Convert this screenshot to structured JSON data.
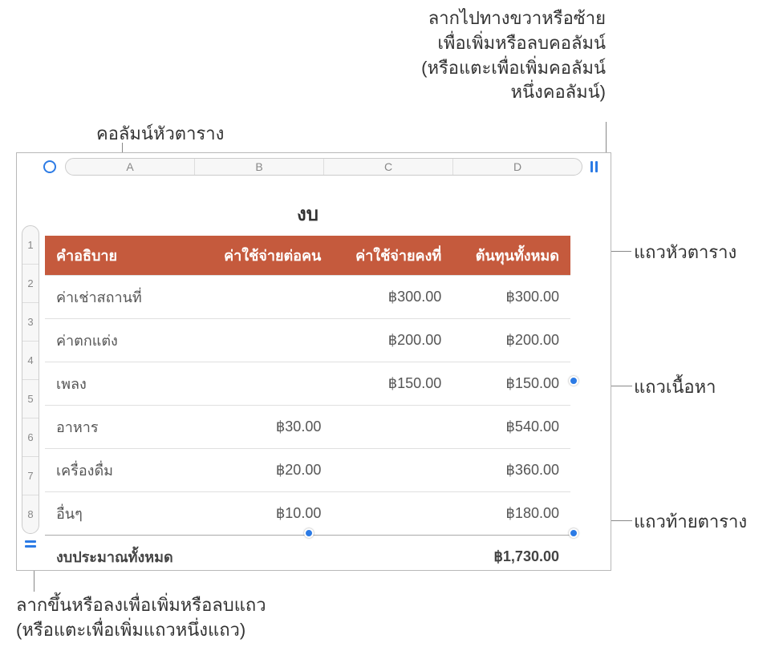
{
  "callouts": {
    "header_column": "คอลัมน์หัวตาราง",
    "drag_columns": "ลากไปทางขวาหรือซ้าย\nเพื่อเพิ่มหรือลบคอลัมน์\n(หรือแตะเพื่อเพิ่มคอลัมน์\nหนึ่งคอลัมน์)",
    "header_row": "แถวหัวตาราง",
    "body_rows": "แถวเนื้อหา",
    "footer_row": "แถวท้ายตาราง",
    "drag_rows": "ลากขึ้นหรือลงเพื่อเพิ่มหรือลบแถว\n(หรือแตะเพื่อเพิ่มแถวหนึ่งแถว)"
  },
  "table": {
    "title": "งบ",
    "columns": [
      "A",
      "B",
      "C",
      "D"
    ],
    "row_numbers": [
      "1",
      "2",
      "3",
      "4",
      "5",
      "6",
      "7",
      "8"
    ],
    "headers": {
      "desc": "คำอธิบาย",
      "per_person": "ค่าใช้จ่ายต่อคน",
      "fixed": "ค่าใช้จ่ายคงที่",
      "total": "ต้นทุนทั้งหมด"
    },
    "rows": [
      {
        "desc": "ค่าเช่าสถานที่",
        "per_person": "",
        "fixed": "฿300.00",
        "total": "฿300.00"
      },
      {
        "desc": "ค่าตกแต่ง",
        "per_person": "",
        "fixed": "฿200.00",
        "total": "฿200.00"
      },
      {
        "desc": "เพลง",
        "per_person": "",
        "fixed": "฿150.00",
        "total": "฿150.00"
      },
      {
        "desc": "อาหาร",
        "per_person": "฿30.00",
        "fixed": "",
        "total": "฿540.00"
      },
      {
        "desc": "เครื่องดื่ม",
        "per_person": "฿20.00",
        "fixed": "",
        "total": "฿360.00"
      },
      {
        "desc": "อื่นๆ",
        "per_person": "฿10.00",
        "fixed": "",
        "total": "฿180.00"
      }
    ],
    "footer": {
      "desc": "งบประมาณทั้งหมด",
      "total": "฿1,730.00"
    }
  }
}
